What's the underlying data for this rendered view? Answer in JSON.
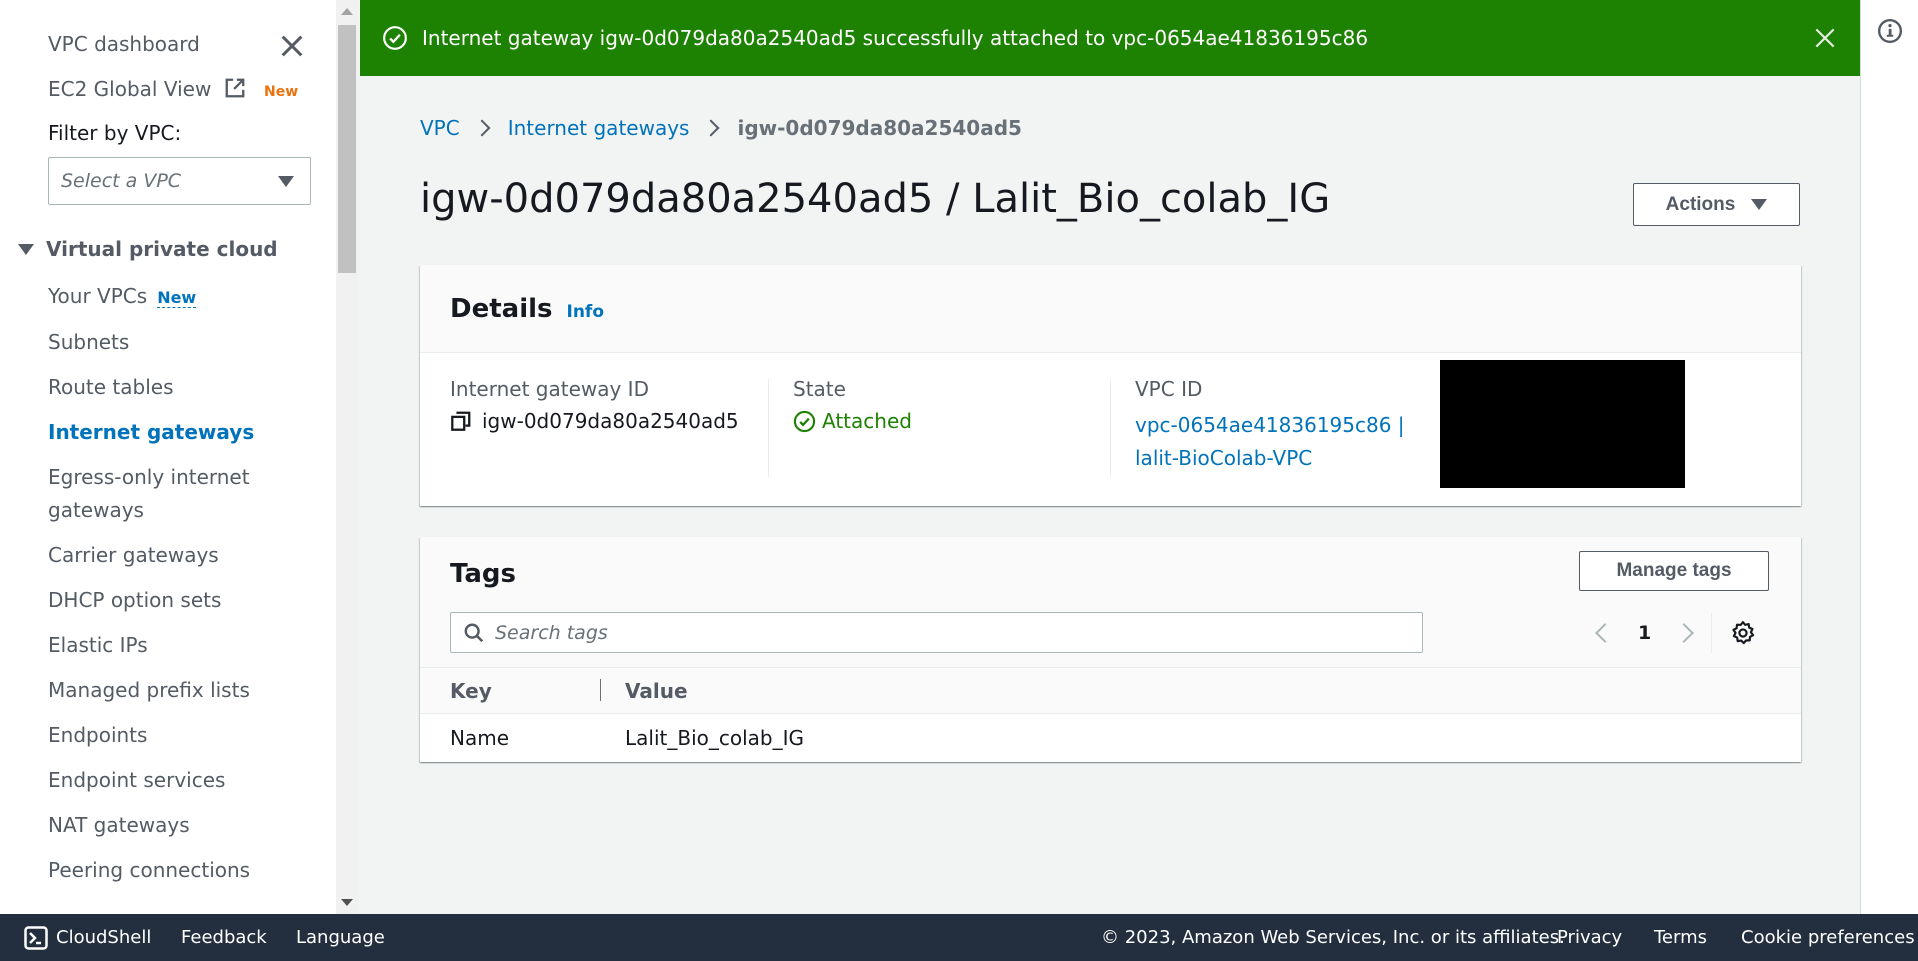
{
  "sidebar": {
    "dashboard_label": "VPC dashboard",
    "ec2_global_view_label": "EC2 Global View",
    "ec2_global_view_badge": "New",
    "filter_label": "Filter by VPC:",
    "filter_select_placeholder": "Select a VPC",
    "section_label": "Virtual private cloud",
    "items": [
      {
        "label": "Your VPCs",
        "badge": "New"
      },
      {
        "label": "Subnets"
      },
      {
        "label": "Route tables"
      },
      {
        "label": "Internet gateways",
        "active": true
      },
      {
        "label": "Egress-only internet gateways"
      },
      {
        "label": "Carrier gateways"
      },
      {
        "label": "DHCP option sets"
      },
      {
        "label": "Elastic IPs"
      },
      {
        "label": "Managed prefix lists"
      },
      {
        "label": "Endpoints"
      },
      {
        "label": "Endpoint services"
      },
      {
        "label": "NAT gateways"
      },
      {
        "label": "Peering connections"
      }
    ]
  },
  "flash": {
    "message": "Internet gateway igw-0d079da80a2540ad5 successfully attached to vpc-0654ae41836195c86",
    "type": "success",
    "color": "#1d8102"
  },
  "breadcrumb": {
    "items": [
      "VPC",
      "Internet gateways"
    ],
    "current": "igw-0d079da80a2540ad5"
  },
  "page": {
    "title": "igw-0d079da80a2540ad5 / Lalit_Bio_colab_IG",
    "actions_label": "Actions"
  },
  "details": {
    "title": "Details",
    "info_label": "Info",
    "gateway_id_label": "Internet gateway ID",
    "gateway_id_value": "igw-0d079da80a2540ad5",
    "state_label": "State",
    "state_value": "Attached",
    "vpc_id_label": "VPC ID",
    "vpc_id_line1": "vpc-0654ae41836195c86 |",
    "vpc_id_line2": "lalit-BioColab-VPC"
  },
  "tags": {
    "title": "Tags",
    "manage_label": "Manage tags",
    "search_placeholder": "Search tags",
    "search_value": "",
    "page_number": "1",
    "columns": [
      "Key",
      "Value"
    ],
    "rows": [
      {
        "key": "Name",
        "value": "Lalit_Bio_colab_IG"
      }
    ]
  },
  "footer": {
    "cloudshell": "CloudShell",
    "feedback": "Feedback",
    "language": "Language",
    "copyright": "© 2023, Amazon Web Services, Inc. or its affiliates.",
    "privacy": "Privacy",
    "terms": "Terms",
    "cookies": "Cookie preferences"
  },
  "colors": {
    "link": "#0073bb",
    "success": "#1d8102",
    "new_badge_orange": "#ec7211",
    "footer_bg": "#232f3e"
  }
}
